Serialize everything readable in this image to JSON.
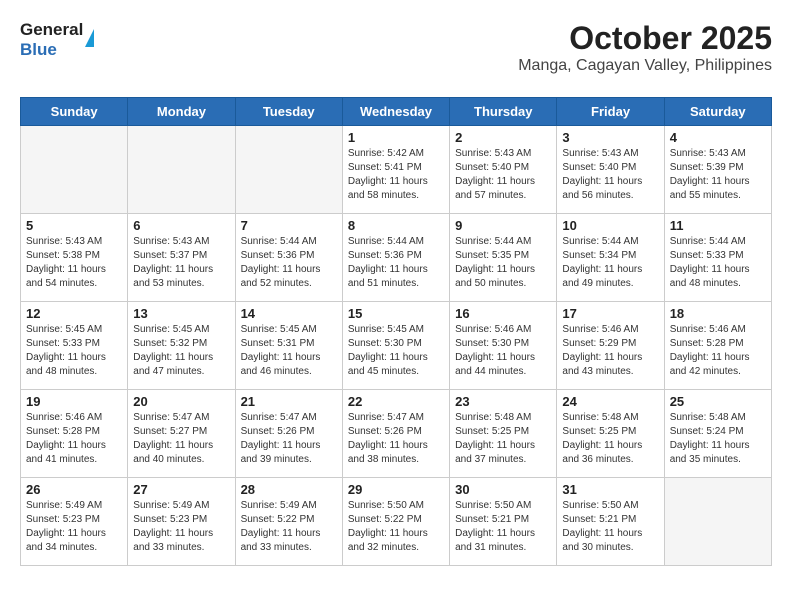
{
  "header": {
    "logo_general": "General",
    "logo_blue": "Blue",
    "month": "October 2025",
    "location": "Manga, Cagayan Valley, Philippines"
  },
  "weekdays": [
    "Sunday",
    "Monday",
    "Tuesday",
    "Wednesday",
    "Thursday",
    "Friday",
    "Saturday"
  ],
  "weeks": [
    [
      {
        "day": "",
        "text": ""
      },
      {
        "day": "",
        "text": ""
      },
      {
        "day": "",
        "text": ""
      },
      {
        "day": "1",
        "text": "Sunrise: 5:42 AM\nSunset: 5:41 PM\nDaylight: 11 hours\nand 58 minutes."
      },
      {
        "day": "2",
        "text": "Sunrise: 5:43 AM\nSunset: 5:40 PM\nDaylight: 11 hours\nand 57 minutes."
      },
      {
        "day": "3",
        "text": "Sunrise: 5:43 AM\nSunset: 5:40 PM\nDaylight: 11 hours\nand 56 minutes."
      },
      {
        "day": "4",
        "text": "Sunrise: 5:43 AM\nSunset: 5:39 PM\nDaylight: 11 hours\nand 55 minutes."
      }
    ],
    [
      {
        "day": "5",
        "text": "Sunrise: 5:43 AM\nSunset: 5:38 PM\nDaylight: 11 hours\nand 54 minutes."
      },
      {
        "day": "6",
        "text": "Sunrise: 5:43 AM\nSunset: 5:37 PM\nDaylight: 11 hours\nand 53 minutes."
      },
      {
        "day": "7",
        "text": "Sunrise: 5:44 AM\nSunset: 5:36 PM\nDaylight: 11 hours\nand 52 minutes."
      },
      {
        "day": "8",
        "text": "Sunrise: 5:44 AM\nSunset: 5:36 PM\nDaylight: 11 hours\nand 51 minutes."
      },
      {
        "day": "9",
        "text": "Sunrise: 5:44 AM\nSunset: 5:35 PM\nDaylight: 11 hours\nand 50 minutes."
      },
      {
        "day": "10",
        "text": "Sunrise: 5:44 AM\nSunset: 5:34 PM\nDaylight: 11 hours\nand 49 minutes."
      },
      {
        "day": "11",
        "text": "Sunrise: 5:44 AM\nSunset: 5:33 PM\nDaylight: 11 hours\nand 48 minutes."
      }
    ],
    [
      {
        "day": "12",
        "text": "Sunrise: 5:45 AM\nSunset: 5:33 PM\nDaylight: 11 hours\nand 48 minutes."
      },
      {
        "day": "13",
        "text": "Sunrise: 5:45 AM\nSunset: 5:32 PM\nDaylight: 11 hours\nand 47 minutes."
      },
      {
        "day": "14",
        "text": "Sunrise: 5:45 AM\nSunset: 5:31 PM\nDaylight: 11 hours\nand 46 minutes."
      },
      {
        "day": "15",
        "text": "Sunrise: 5:45 AM\nSunset: 5:30 PM\nDaylight: 11 hours\nand 45 minutes."
      },
      {
        "day": "16",
        "text": "Sunrise: 5:46 AM\nSunset: 5:30 PM\nDaylight: 11 hours\nand 44 minutes."
      },
      {
        "day": "17",
        "text": "Sunrise: 5:46 AM\nSunset: 5:29 PM\nDaylight: 11 hours\nand 43 minutes."
      },
      {
        "day": "18",
        "text": "Sunrise: 5:46 AM\nSunset: 5:28 PM\nDaylight: 11 hours\nand 42 minutes."
      }
    ],
    [
      {
        "day": "19",
        "text": "Sunrise: 5:46 AM\nSunset: 5:28 PM\nDaylight: 11 hours\nand 41 minutes."
      },
      {
        "day": "20",
        "text": "Sunrise: 5:47 AM\nSunset: 5:27 PM\nDaylight: 11 hours\nand 40 minutes."
      },
      {
        "day": "21",
        "text": "Sunrise: 5:47 AM\nSunset: 5:26 PM\nDaylight: 11 hours\nand 39 minutes."
      },
      {
        "day": "22",
        "text": "Sunrise: 5:47 AM\nSunset: 5:26 PM\nDaylight: 11 hours\nand 38 minutes."
      },
      {
        "day": "23",
        "text": "Sunrise: 5:48 AM\nSunset: 5:25 PM\nDaylight: 11 hours\nand 37 minutes."
      },
      {
        "day": "24",
        "text": "Sunrise: 5:48 AM\nSunset: 5:25 PM\nDaylight: 11 hours\nand 36 minutes."
      },
      {
        "day": "25",
        "text": "Sunrise: 5:48 AM\nSunset: 5:24 PM\nDaylight: 11 hours\nand 35 minutes."
      }
    ],
    [
      {
        "day": "26",
        "text": "Sunrise: 5:49 AM\nSunset: 5:23 PM\nDaylight: 11 hours\nand 34 minutes."
      },
      {
        "day": "27",
        "text": "Sunrise: 5:49 AM\nSunset: 5:23 PM\nDaylight: 11 hours\nand 33 minutes."
      },
      {
        "day": "28",
        "text": "Sunrise: 5:49 AM\nSunset: 5:22 PM\nDaylight: 11 hours\nand 33 minutes."
      },
      {
        "day": "29",
        "text": "Sunrise: 5:50 AM\nSunset: 5:22 PM\nDaylight: 11 hours\nand 32 minutes."
      },
      {
        "day": "30",
        "text": "Sunrise: 5:50 AM\nSunset: 5:21 PM\nDaylight: 11 hours\nand 31 minutes."
      },
      {
        "day": "31",
        "text": "Sunrise: 5:50 AM\nSunset: 5:21 PM\nDaylight: 11 hours\nand 30 minutes."
      },
      {
        "day": "",
        "text": ""
      }
    ]
  ]
}
